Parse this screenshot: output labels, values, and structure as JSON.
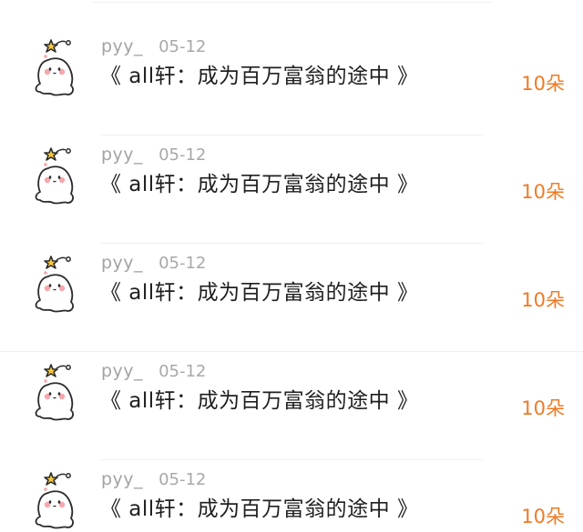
{
  "gifts": [
    {
      "user": "pyy_",
      "date": "05-12",
      "title": "《 all轩：成为百万富翁的途中 》",
      "amount": "10朵"
    },
    {
      "user": "pyy_",
      "date": "05-12",
      "title": "《 all轩：成为百万富翁的途中 》",
      "amount": "10朵"
    },
    {
      "user": "pyy_",
      "date": "05-12",
      "title": "《 all轩：成为百万富翁的途中 》",
      "amount": "10朵"
    },
    {
      "user": "pyy_",
      "date": "05-12",
      "title": "《 all轩：成为百万富翁的途中 》",
      "amount": "10朵"
    },
    {
      "user": "pyy_",
      "date": "05-12",
      "title": "《 all轩：成为百万富翁的途中 》",
      "amount": "10朵"
    }
  ],
  "colors": {
    "amount": "#f07a23",
    "username": "#a3a3a3",
    "title": "#1f1f1f"
  },
  "icons": {
    "avatar": "ghost-with-star-icon"
  }
}
